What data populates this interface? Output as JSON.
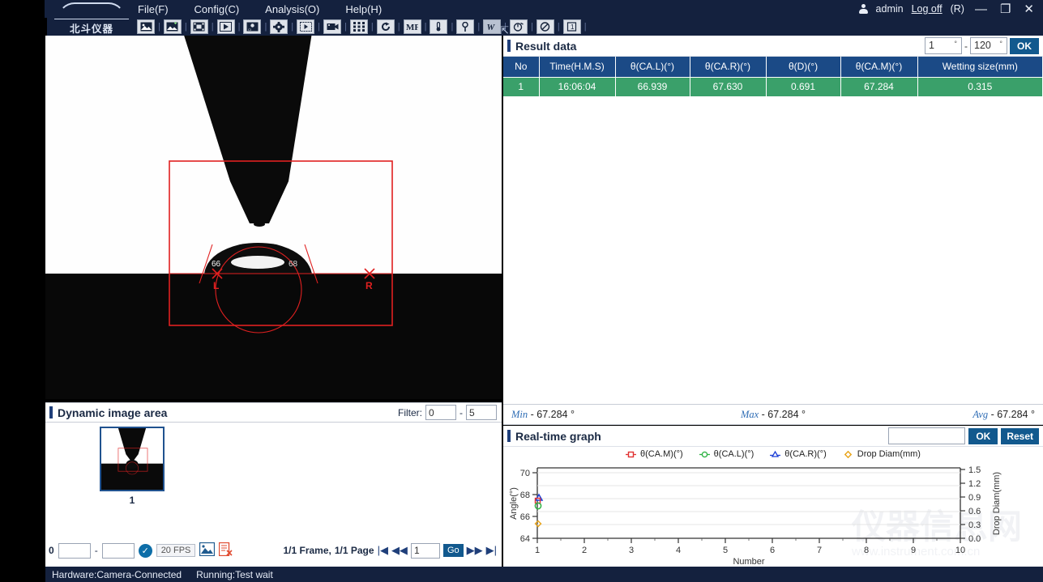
{
  "window": {
    "logo_text": "北斗仪器",
    "user": "admin",
    "logoff": "Log off",
    "shortcut": "(R)",
    "minimize": "—",
    "restore": "❐",
    "close": "✕"
  },
  "menu": [
    {
      "label": "File(F)",
      "name": "menu-file"
    },
    {
      "label": "Config(C)",
      "name": "menu-config"
    },
    {
      "label": "Analysis(O)",
      "name": "menu-analysis"
    },
    {
      "label": "Help(H)",
      "name": "menu-help"
    }
  ],
  "toolbar": {
    "buttons": [
      {
        "icon": "image-icon",
        "title": "Image"
      },
      {
        "icon": "image-add-icon",
        "title": "Open image"
      },
      {
        "icon": "film-icon",
        "title": "Video"
      },
      {
        "icon": "play-icon",
        "title": "Play"
      },
      {
        "icon": "capture-icon",
        "title": "Capture"
      },
      {
        "icon": "gear-icon",
        "title": "Settings"
      },
      {
        "icon": "frames-icon",
        "title": "Frames"
      },
      {
        "icon": "camera-icon",
        "title": "Camera"
      },
      {
        "icon": "grid-icon",
        "title": "Grid"
      },
      {
        "icon": "refresh-icon",
        "title": "Refresh"
      },
      {
        "icon": "mf-icon",
        "title": "MF"
      },
      {
        "icon": "thermometer-icon",
        "title": "Temperature"
      },
      {
        "icon": "tension-icon",
        "title": "Surface tension"
      },
      {
        "icon": "w-icon",
        "title": "Wetting"
      },
      {
        "icon": "timer-icon",
        "title": "Timer"
      },
      {
        "icon": "nodrop-icon",
        "title": "No drop"
      },
      {
        "icon": "one-icon",
        "title": "Single"
      }
    ]
  },
  "image_area": {
    "name": "contact-angle-image",
    "angle_left_label": "66",
    "angle_right_label": "68",
    "marker_left": "L",
    "marker_right": "R"
  },
  "dynamic_image": {
    "title": "Dynamic image area",
    "filter_label": "Filter:",
    "filter_from": "0",
    "filter_to": "5",
    "thumbnail_label": "1",
    "index_value": "0",
    "range_from": "",
    "range_to": "",
    "fps": "20 FPS",
    "frame_text": "1/1 Frame,",
    "page_text": "1/1 Page",
    "page_input": "1",
    "go_label": "Go"
  },
  "result_data": {
    "title": "Result data",
    "range_from": "1",
    "range_to": "120",
    "degree_symbol": "°",
    "separator": "-",
    "ok_label": "OK",
    "columns": [
      "No",
      "Time(H.M.S)",
      "θ(CA.L)(°)",
      "θ(CA.R)(°)",
      "θ(D)(°)",
      "θ(CA.M)(°)",
      "Wetting size(mm)"
    ],
    "rows": [
      [
        "1",
        "16:06:04",
        "66.939",
        "67.630",
        "0.691",
        "67.284",
        "0.315"
      ]
    ]
  },
  "stats": {
    "min_key": "Min",
    "min_value": "- 67.284 °",
    "max_key": "Max",
    "max_value": "- 67.284 °",
    "avg_key": "Avg",
    "avg_value": "- 67.284 °"
  },
  "graph": {
    "title": "Real-time graph",
    "input_value": "",
    "ok_label": "OK",
    "reset_label": "Reset"
  },
  "chart_data": {
    "type": "scatter",
    "title": "Real-time graph",
    "xlabel": "Number",
    "ylabel": "Angle(°)",
    "y2label": "Drop Diam(mm)",
    "xlim": [
      1,
      10
    ],
    "xticks": [
      1,
      2,
      3,
      4,
      5,
      6,
      7,
      8,
      9,
      10
    ],
    "ylim": [
      63,
      71
    ],
    "yticks": [
      64,
      66,
      68,
      70
    ],
    "y2lim": [
      0,
      1.5
    ],
    "y2ticks": [
      0.0,
      0.3,
      0.6,
      0.9,
      1.2,
      1.5
    ],
    "grid": true,
    "legend_position": "top-center",
    "series": [
      {
        "name": "θ(CA.M)(°)",
        "color": "#e03131",
        "marker": "square",
        "axis": "left",
        "x": [
          1
        ],
        "values": [
          67.284
        ]
      },
      {
        "name": "θ(CA.L)(°)",
        "color": "#2fb344",
        "marker": "circle",
        "axis": "left",
        "x": [
          1
        ],
        "values": [
          66.939
        ]
      },
      {
        "name": "θ(CA.R)(°)",
        "color": "#1c3fd6",
        "marker": "triangle",
        "axis": "left",
        "x": [
          1
        ],
        "values": [
          67.63
        ]
      },
      {
        "name": "Drop Diam(mm)",
        "color": "#e8a317",
        "marker": "diamond",
        "axis": "right",
        "x": [
          1
        ],
        "values": [
          0.315
        ]
      }
    ]
  },
  "statusbar": {
    "hardware": "Hardware:Camera-Connected",
    "running": "Running:Test wait"
  },
  "watermark": {
    "text": "仪器信息网",
    "sub": "www.instrument.com.cn"
  },
  "colors": {
    "titlebar": "#14213e",
    "accent": "#12598e",
    "table_header": "#1b4a86",
    "table_row": "#3aa06a",
    "overlay_red": "#e02020"
  }
}
